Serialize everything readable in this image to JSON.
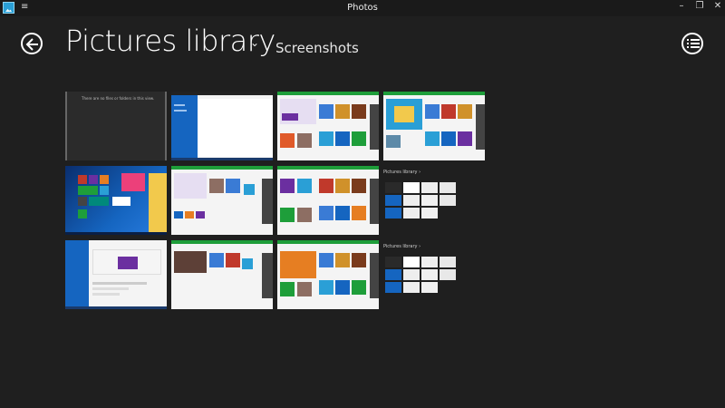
{
  "window": {
    "title": "Photos",
    "minimize": "–",
    "restore": "❐",
    "close": "✕"
  },
  "header": {
    "title": "Pictures library",
    "subtitle": "Screenshots"
  },
  "thumbnails": {
    "empty_folder_text": "There are no files or folders in this view.",
    "nested_label_1": "Pictures library ›",
    "nested_label_2": "Pictures library ›"
  },
  "icons": {
    "back": "back-arrow-icon",
    "chevron": "chevron-down-icon",
    "select": "list-select-icon",
    "menu": "hamburger-icon"
  },
  "colors": {
    "background": "#1f1f1f",
    "accent_green": "#1e9e3a",
    "accent_blue": "#1565c0",
    "purple": "#6b2fa0"
  }
}
